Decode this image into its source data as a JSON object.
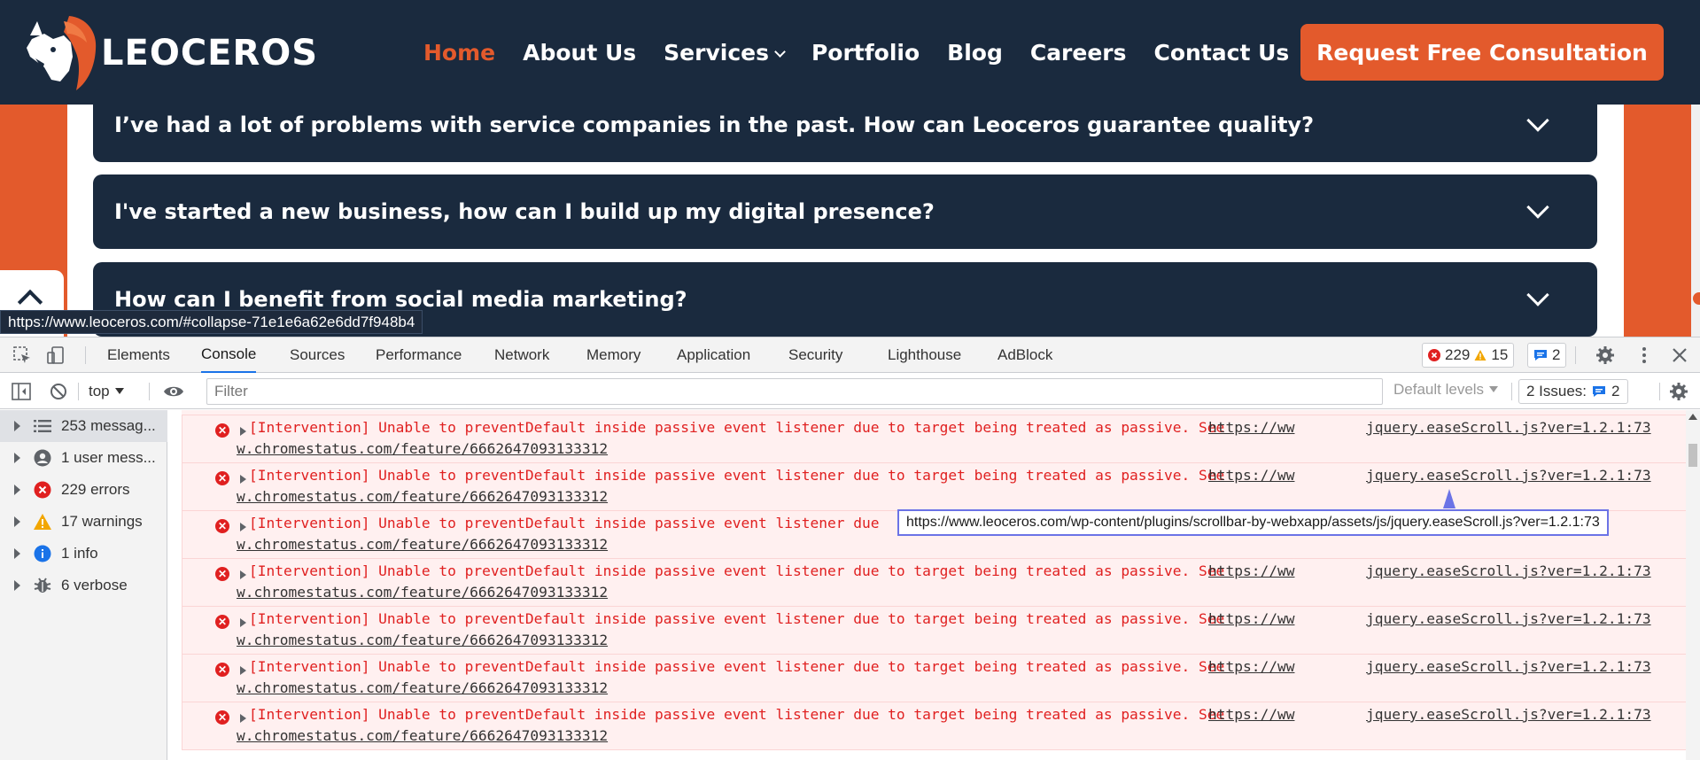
{
  "site": {
    "logo_text": "LEOCEROS",
    "nav": [
      {
        "label": "Home",
        "active": true
      },
      {
        "label": "About Us"
      },
      {
        "label": "Services"
      },
      {
        "label": "Portfolio"
      },
      {
        "label": "Blog"
      },
      {
        "label": "Careers"
      },
      {
        "label": "Contact Us"
      }
    ],
    "cta": "Request Free Consultation",
    "faqs": [
      "I’ve had a lot of problems with service companies in the past. How can Leoceros guarantee quality?",
      "I've started a new business, how can I build up my digital presence?",
      "How can I benefit from social media marketing?"
    ],
    "status_url": "https://www.leoceros.com/#collapse-71e1e6a62e6dd7f948b4",
    "colors": {
      "navy": "#1a2a3e",
      "orange": "#e35a2c"
    }
  },
  "devtools": {
    "tabs": [
      "Elements",
      "Console",
      "Sources",
      "Performance",
      "Network",
      "Memory",
      "Application",
      "Security",
      "Lighthouse",
      "AdBlock"
    ],
    "active_tab": "Console",
    "counts": {
      "errors": "229",
      "warnings": "15",
      "messages": "2"
    },
    "toolbar": {
      "context": "top",
      "filter_placeholder": "Filter",
      "levels": "Default levels",
      "issues_label": "2 Issues:",
      "issues_count": "2"
    },
    "sidebar": [
      {
        "label": "253 messag...",
        "icon": "list-icon"
      },
      {
        "label": "1 user mess...",
        "icon": "user-icon"
      },
      {
        "label": "229 errors",
        "icon": "error-icon"
      },
      {
        "label": "17 warnings",
        "icon": "warning-icon"
      },
      {
        "label": "1 info",
        "icon": "info-icon"
      },
      {
        "label": "6 verbose",
        "icon": "bug-icon"
      }
    ],
    "log": {
      "message": "[Intervention] Unable to preventDefault inside passive event listener due to target being treated as passive. See",
      "message_short": "[Intervention] Unable to preventDefault inside passive event listener due",
      "link_part1": "https://ww",
      "link_part2": "w.chromestatus.com/feature/6662647093133312",
      "source": "jquery.easeScroll.js?ver=1.2.1:73"
    },
    "tooltip": "https://www.leoceros.com/wp-content/plugins/scrollbar-by-webxapp/assets/js/jquery.easeScroll.js?ver=1.2.1:73"
  }
}
